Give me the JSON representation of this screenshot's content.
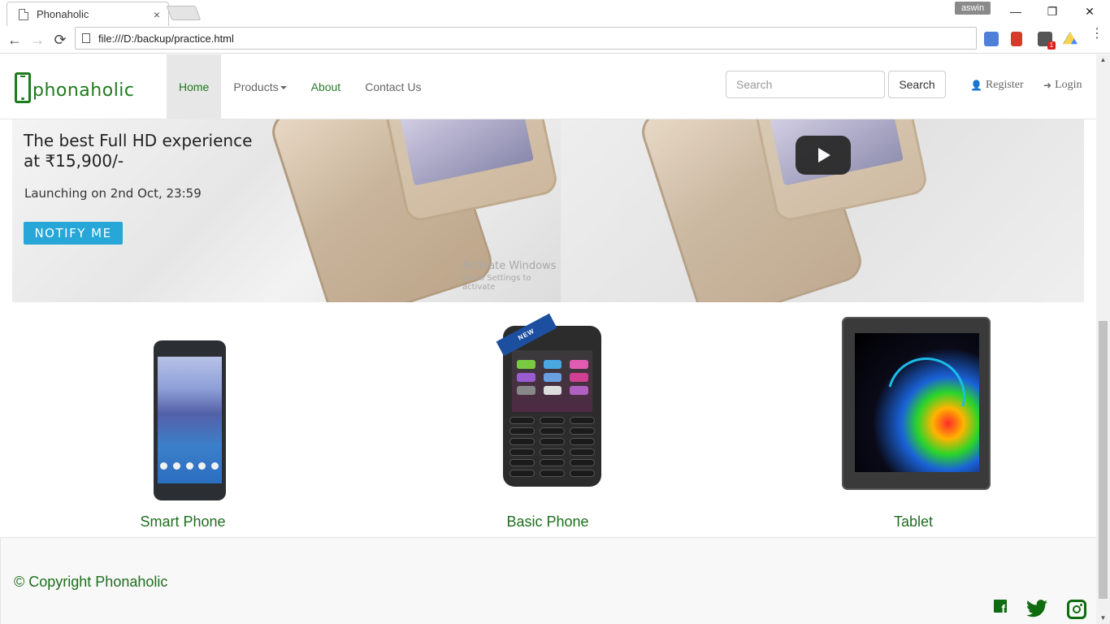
{
  "browser": {
    "tab_title": "Phonaholic",
    "tab_close": "×",
    "user": "aswin",
    "url": "file:///D:/backup/practice.html",
    "minimize": "—",
    "restore": "❐",
    "close": "✕",
    "back": "←",
    "forward": "→",
    "reload": "⟳",
    "menu": "⋮",
    "extension_badge": "1"
  },
  "navbar": {
    "brand": "phonaholic",
    "links": [
      {
        "label": "Home",
        "active": true
      },
      {
        "label": "Products",
        "dropdown": true
      },
      {
        "label": "About"
      },
      {
        "label": "Contact Us"
      }
    ],
    "search_placeholder": "Search",
    "search_button": "Search",
    "register": "Register",
    "login": "Login"
  },
  "carousel": {
    "title": "The best Full HD experience at ₹15,900/-",
    "subtitle": "Launching on 2nd Oct, 23:59",
    "button": "NOTIFY ME",
    "watermark_line1": "Activate Windows",
    "watermark_line2": "Go to Settings to activate"
  },
  "products": [
    {
      "label": "Smart Phone"
    },
    {
      "label": "Basic Phone",
      "badge": "NEW"
    },
    {
      "label": "Tablet"
    }
  ],
  "footer": {
    "copyright": "© Copyright Phonaholic",
    "social": [
      "facebook-icon",
      "twitter-icon",
      "instagram-icon"
    ]
  },
  "colors": {
    "brand_green": "#1e7b1e",
    "notify_blue": "#27a6d8",
    "active_nav_bg": "#e7e7e7"
  }
}
